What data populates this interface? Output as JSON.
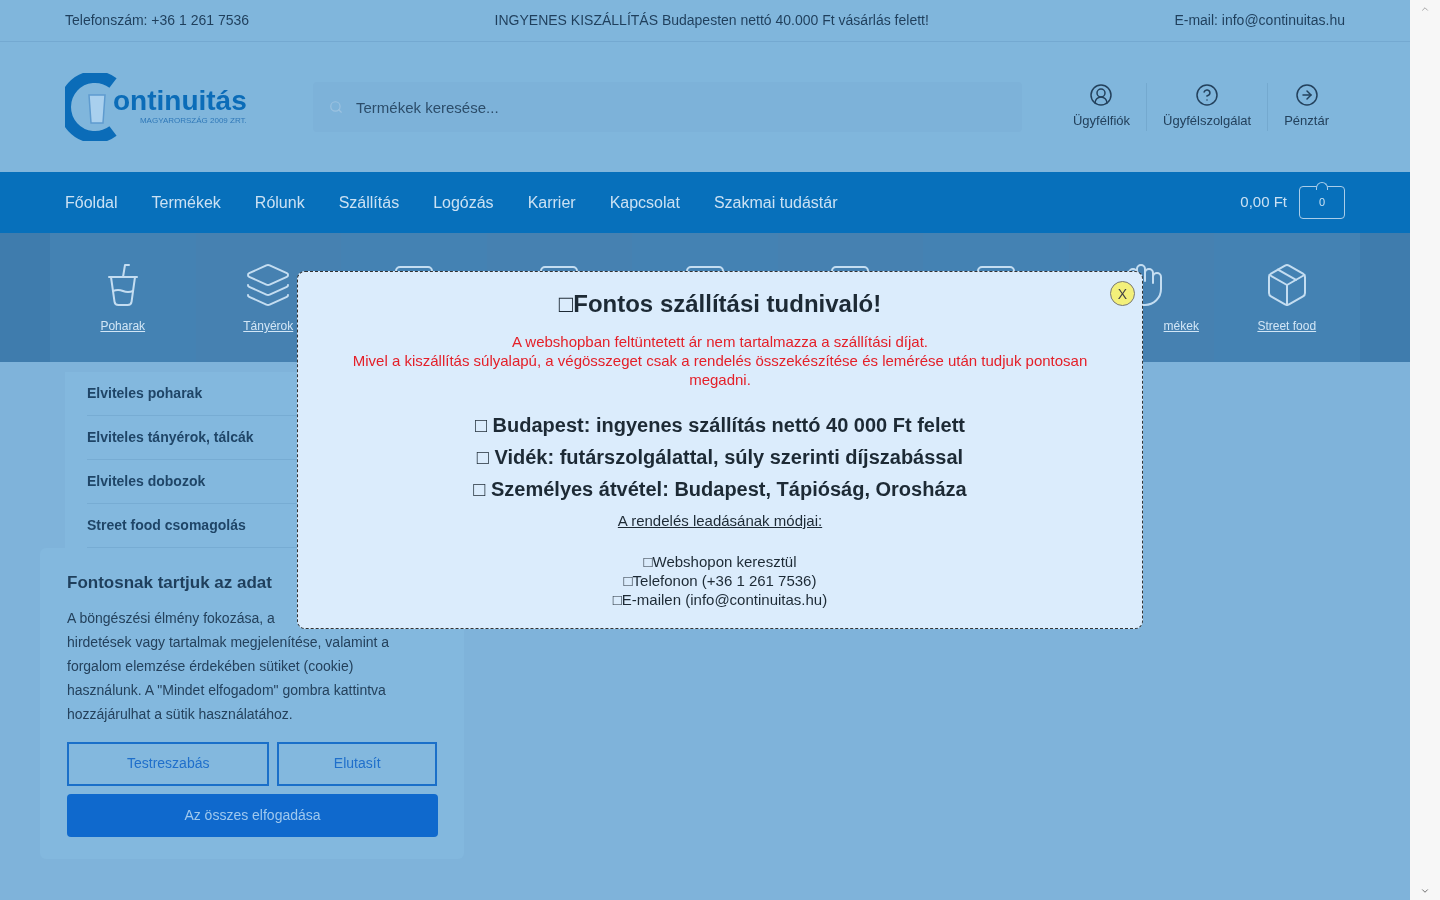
{
  "top_bar": {
    "phone": "Telefonszám: +36 1 261 7536",
    "promo": "INGYENES KISZÁLLÍTÁS Budapesten nettó 40.000 Ft vásárlás felett!",
    "email": "E-mail: info@continuitas.hu"
  },
  "logo": {
    "name": "ontinuitás",
    "tagline": "MAGYARORSZÁG 2009 ZRT."
  },
  "search": {
    "placeholder": "Termékek keresése..."
  },
  "header_links": [
    {
      "kind": "account",
      "label": "Ügyfélfiók"
    },
    {
      "kind": "help",
      "label": "Ügyfélszolgálat"
    },
    {
      "kind": "checkout",
      "label": "Pénztár"
    }
  ],
  "nav": {
    "items": [
      "Főoldal",
      "Termékek",
      "Rólunk",
      "Szállítás",
      "Logózás",
      "Karrier",
      "Kapcsolat",
      "Szakmai tudástár"
    ],
    "cart_total": "0,00 Ft",
    "cart_count": "0"
  },
  "categories": [
    {
      "kind": "cup",
      "label": "Poharak"
    },
    {
      "kind": "tray",
      "label": "Tányérok"
    },
    {
      "kind": "hidden"
    },
    {
      "kind": "hidden"
    },
    {
      "kind": "hidden"
    },
    {
      "kind": "hidden"
    },
    {
      "kind": "hidden"
    },
    {
      "kind": "hand",
      "label": "mékek"
    },
    {
      "kind": "box",
      "label": "Street food"
    }
  ],
  "sidebar": {
    "items": [
      "Elviteles poharak",
      "Elviteles tányérok, tálcák",
      "Elviteles dobozok",
      "Street food csomagolás"
    ]
  },
  "cookie": {
    "title": "Fontosnak tartjuk az adat",
    "lines": [
      "A böngészési élmény fokozása, a",
      "hirdetések vagy tartalmak megjelenítése, valamint a",
      "forgalom elemzése érdekében sütiket (cookie)",
      "használunk. A \"Mindet elfogadom\" gombra kattintva",
      "hozzájárulhat a sütik használatához."
    ],
    "customize": "Testreszabás",
    "reject": "Elutasít",
    "accept_all": "Az összes elfogadása"
  },
  "modal": {
    "close": "X",
    "title": "□Fontos szállítási tudnivaló!",
    "warning": [
      "A webshopban feltüntetett ár nem tartalmazza a szállítási díjat.",
      "Mivel a kiszállítás súlyalapú, a végösszeget csak a rendelés összekészítése és lemérése után tudjuk pontosan megadni."
    ],
    "points": [
      "□ Budapest: ingyenes szállítás nettó 40 000 Ft felett",
      "□ Vidék: futárszolgálattal, súly szerinti díjszabással",
      "□ Személyes átvétel: Budapest, Tápióság, Orosháza"
    ],
    "methods_title": "A rendelés leadásának módjai:",
    "methods": [
      "□Webshopon keresztül",
      "□Telefonon (+36 1 261 7536)",
      "□E-mailen (info@continuitas.hu)"
    ]
  }
}
